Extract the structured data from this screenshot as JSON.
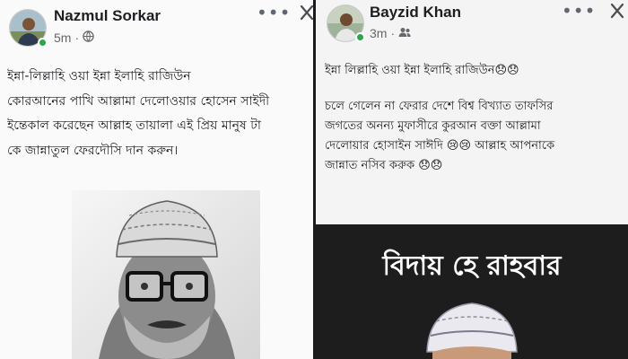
{
  "left_post": {
    "author": "Nazmul Sorkar",
    "time": "5m",
    "time_separator": "·",
    "privacy_icon": "globe-icon",
    "text_lines": [
      "ইন্না-লিল্লাহি ওয়া ইন্না ইলাহি রাজিউন",
      "কোরআনের পাখি আল্লামা দেলোওয়ার হোসেন সাইদী",
      "ইন্তেকাল করেছেন আল্লাহ তায়ালা এই প্রিয় মানুষ টা",
      "কে জান্নাতুল ফেরদৌসি দান করুন।"
    ]
  },
  "right_post": {
    "author": "Bayzid Khan",
    "time": "3m",
    "time_separator": "·",
    "privacy_icon": "friends-icon",
    "text_lines": [
      "ইন্না লিল্লাহি ওয়া ইন্না ইলাহি রাজিউন😞😞",
      "চলে গেলেন না ফেরার দেশে বিশ্ব বিখ্যাত তাফসির",
      "জগতের অনন্য মুফাসীরে কুরআন বক্তা আল্লামা",
      "দেলোয়ার হোসাইন সাঈদি 😢😢 আল্লাহ আপনাকে",
      "জান্নাত নসিব করুক 😞😞"
    ],
    "banner_title": "বিদায় হে রাহবার"
  },
  "colors": {
    "online": "#31a24c",
    "banner_background": "#1d1d1d",
    "author_text": "#1c1e21",
    "meta_text": "#65676b"
  },
  "icons": [
    "more-options-icon",
    "close-icon",
    "globe-icon",
    "friends-icon"
  ]
}
